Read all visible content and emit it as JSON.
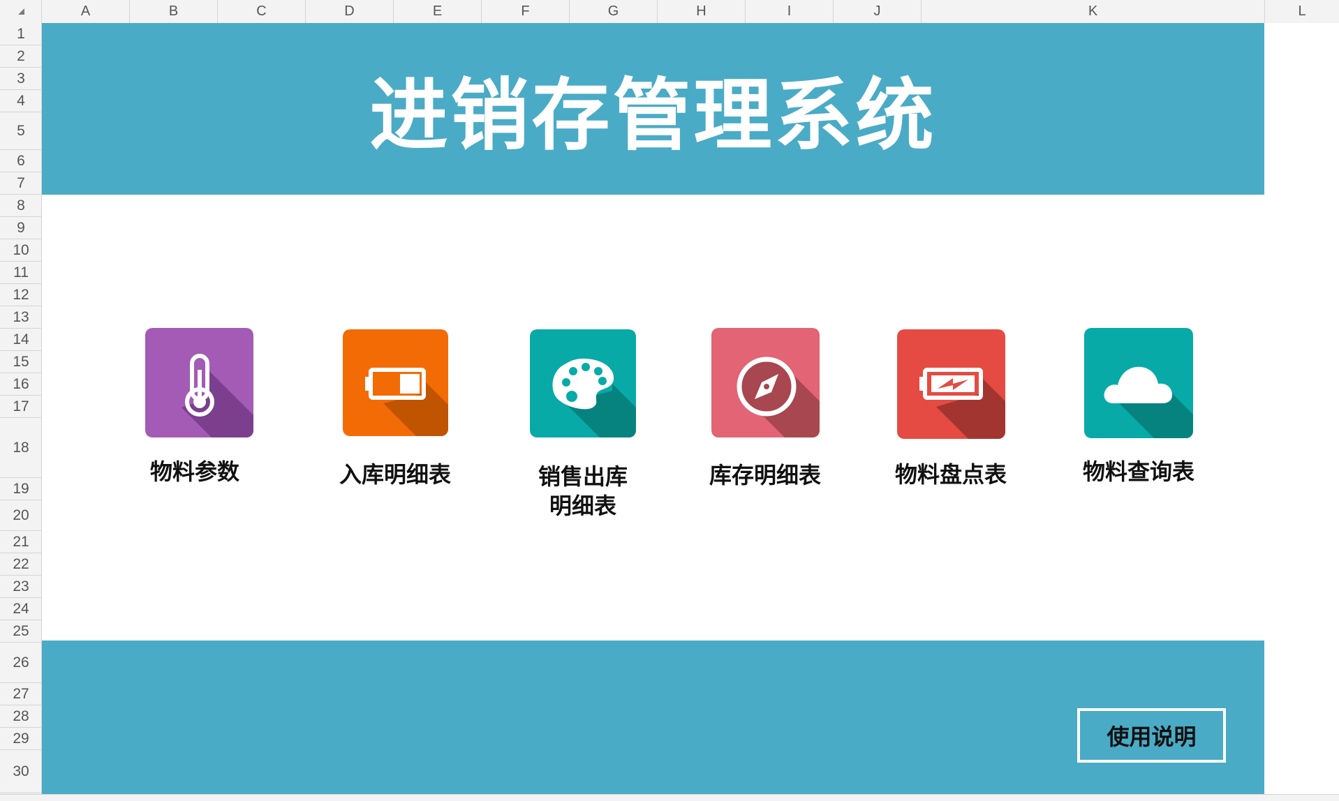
{
  "spreadsheet": {
    "columns": [
      "A",
      "B",
      "C",
      "D",
      "E",
      "F",
      "G",
      "H",
      "I",
      "J",
      "K",
      "L"
    ],
    "rows": [
      "1",
      "2",
      "3",
      "4",
      "5",
      "6",
      "7",
      "8",
      "9",
      "10",
      "11",
      "12",
      "13",
      "14",
      "15",
      "16",
      "17",
      "18",
      "19",
      "20",
      "21",
      "22",
      "23",
      "24",
      "25",
      "26",
      "27",
      "28",
      "29",
      "30"
    ]
  },
  "dashboard": {
    "title": "进销存管理系统",
    "help_button": "使用说明",
    "banner_color": "#4aabc6",
    "tiles": [
      {
        "label": "物料参数",
        "icon": "thermometer-icon",
        "color": "#a35bb5",
        "shadow": "#7b3f8e"
      },
      {
        "label": "入库明细表",
        "icon": "battery-icon",
        "color": "#f36b05",
        "shadow": "#c05400"
      },
      {
        "label": "销售出库\n明细表",
        "icon": "palette-icon",
        "color": "#08aaa8",
        "shadow": "#07837f"
      },
      {
        "label": "库存明细表",
        "icon": "compass-icon",
        "color": "#e36474",
        "shadow": "#a8474f"
      },
      {
        "label": "物料盘点表",
        "icon": "battery-charging-icon",
        "color": "#e54b42",
        "shadow": "#a23530"
      },
      {
        "label": "物料查询表",
        "icon": "cloud-icon",
        "color": "#08aaa8",
        "shadow": "#07837f"
      }
    ]
  }
}
